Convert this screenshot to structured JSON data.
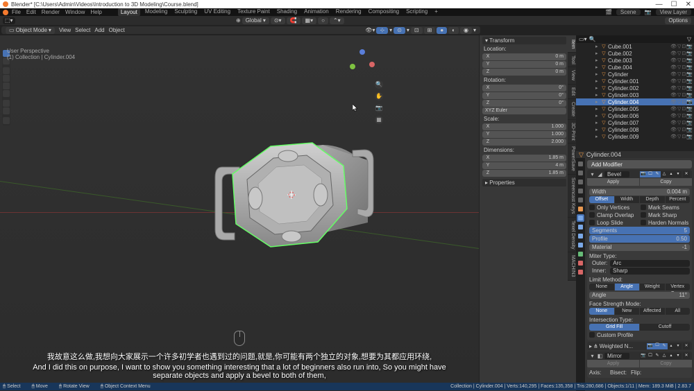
{
  "window": {
    "title": "Blender* [C:\\Users\\Admin\\Videos\\Introduction to 3D Modeling\\Course.blend]"
  },
  "menu": {
    "file": "File",
    "edit": "Edit",
    "render": "Render",
    "window": "Window",
    "help": "Help"
  },
  "workspaces": {
    "layout": "Layout",
    "modeling": "Modeling",
    "sculpting": "Sculpting",
    "uv": "UV Editing",
    "tex": "Texture Paint",
    "shading": "Shading",
    "anim": "Animation",
    "rendering": "Rendering",
    "comp": "Compositing",
    "scripting": "Scripting"
  },
  "scene": {
    "label": "Scene",
    "layer": "View Layer"
  },
  "header": {
    "mode": "Object Mode",
    "view": "View",
    "select": "Select",
    "add": "Add",
    "object": "Object",
    "orientation": "Global",
    "options": "Options"
  },
  "vpinfo": {
    "persp": "User Perspective",
    "coll": "(1) Collection | Cylinder.004"
  },
  "npanel": {
    "transform": "Transform",
    "location": "Location:",
    "rotation": "Rotation:",
    "mode": "XYZ Euler",
    "scale": "Scale:",
    "dim": "Dimensions:",
    "properties": "Properties",
    "loc": {
      "x": "0 m",
      "y": "0 m",
      "z": "0 m"
    },
    "rot": {
      "x": "0°",
      "y": "0°",
      "z": "0°"
    },
    "scl": {
      "x": "1.000",
      "y": "1.000",
      "z": "2.000"
    },
    "d": {
      "x": "1.85 m",
      "y": "4 m",
      "z": "1.85 m"
    },
    "tabs": {
      "item": "Item",
      "tool": "Tool",
      "view": "View",
      "edit": "Edit",
      "create": "Create",
      "print": "3D-Print",
      "sk": "Screencast Keys",
      "td": "Texel Density",
      "m": "MACHIN3",
      "ps": "PowerSave"
    }
  },
  "outliner": {
    "items": [
      {
        "name": "Cube.001",
        "type": "mesh",
        "indent": 24
      },
      {
        "name": "Cube.002",
        "type": "mesh",
        "indent": 24
      },
      {
        "name": "Cube.003",
        "type": "mesh",
        "indent": 24
      },
      {
        "name": "Cube.004",
        "type": "mesh",
        "indent": 24
      },
      {
        "name": "Cylinder",
        "type": "mesh",
        "indent": 24
      },
      {
        "name": "Cylinder.001",
        "type": "mesh",
        "indent": 24
      },
      {
        "name": "Cylinder.002",
        "type": "mesh",
        "indent": 24
      },
      {
        "name": "Cylinder.003",
        "type": "mesh",
        "indent": 24
      },
      {
        "name": "Cylinder.004",
        "type": "mesh",
        "indent": 24,
        "sel": true
      },
      {
        "name": "Cylinder.005",
        "type": "mesh",
        "indent": 24
      },
      {
        "name": "Cylinder.006",
        "type": "mesh",
        "indent": 24
      },
      {
        "name": "Cylinder.007",
        "type": "mesh",
        "indent": 24
      },
      {
        "name": "Cylinder.008",
        "type": "mesh",
        "indent": 24
      },
      {
        "name": "Cylinder.009",
        "type": "mesh",
        "indent": 24
      }
    ],
    "crumb": "Cylinder.004"
  },
  "props": {
    "addmod": "Add Modifier",
    "bevel": {
      "title": "Bevel",
      "apply": "Apply",
      "copy": "Copy",
      "width_l": "Width",
      "width_v": "0.004 m",
      "tabs": {
        "offset": "Offset",
        "width": "Width",
        "depth": "Depth",
        "percent": "Percent"
      },
      "onlyv": "Only Vertices",
      "markseams": "Mark Seams",
      "clamp": "Clamp Overlap",
      "marksharp": "Mark Sharp",
      "loopslide": "Loop Slide",
      "harden": "Harden Normals",
      "seg_l": "Segments",
      "seg_v": "5",
      "prof_l": "Profile",
      "prof_v": "0.50",
      "mat_l": "Material",
      "mat_v": "-1",
      "miter": "Miter Type:",
      "outer_l": "Outer:",
      "outer_v": "Arc",
      "inner_l": "Inner:",
      "inner_v": "Sharp",
      "limit": "Limit Method:",
      "limopts": {
        "none": "None",
        "angle": "Angle",
        "weight": "Weight",
        "vgroup": "Vertex Group"
      },
      "angle_l": "Angle",
      "angle_v": "11°",
      "fsm": "Face Strength Mode:",
      "fsmopts": {
        "none": "None",
        "new": "New",
        "affected": "Affected",
        "all": "All"
      },
      "itype": "Intersection Type:",
      "iopts": {
        "grid": "Grid Fill",
        "cutoff": "Cutoff"
      },
      "custom": "Custom Profile"
    },
    "weighted": "Weighted N...",
    "mirror": {
      "title": "Mirror",
      "apply": "Apply",
      "copy": "Copy",
      "axis": "Axis:",
      "bisect": "Bisect:",
      "flip": "Flip:"
    }
  },
  "status": {
    "select": "Select",
    "move": "Move",
    "rotate": "Rotate View",
    "menu": "Object Context Menu",
    "right": "Collection | Cylinder.004 | Verts:140,295 | Faces:135,358 | Tris:280,686 | Objects:1/11 | Mem: 189.3 MiB | 2.83.7"
  },
  "subs": {
    "cn": "我故意这么做,我想向大家展示一个许多初学者也遇到过的问题,就是,你可能有两个独立的对象,想要为其都应用环绕,",
    "en": "And I did this on purpose, I want to show you something interesting that a lot of beginners also run into, So you might have separate objects and apply a bevel to both of them,"
  }
}
